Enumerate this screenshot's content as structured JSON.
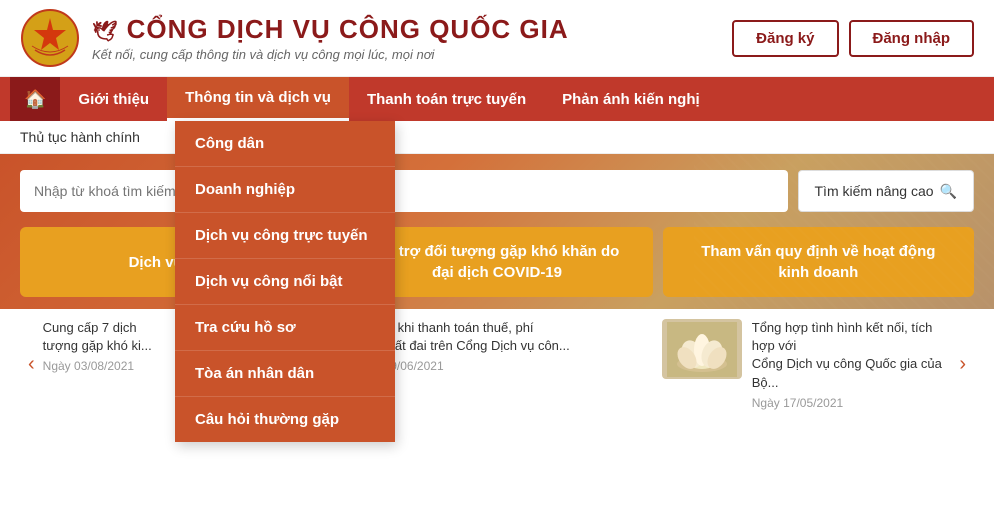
{
  "header": {
    "site_title": "CỔNG DỊCH VỤ CÔNG QUỐC GIA",
    "subtitle": "Kết nối, cung cấp thông tin và dịch vụ công mọi lúc, mọi nơi",
    "btn_register": "Đăng ký",
    "btn_login": "Đăng nhập"
  },
  "nav": {
    "home_icon": "🏠",
    "items": [
      {
        "label": "Giới thiệu",
        "active": false
      },
      {
        "label": "Thông tin và dịch vụ",
        "active": true
      },
      {
        "label": "Thanh toán trực tuyến",
        "active": false
      },
      {
        "label": "Phản ánh kiến nghị",
        "active": false
      }
    ]
  },
  "breadcrumb": "Thủ tục hành chính",
  "dropdown": {
    "items": [
      "Công dân",
      "Doanh nghiệp",
      "Dịch vụ công trực tuyến",
      "Dịch vụ công nổi bật",
      "Tra cứu hồ sơ",
      "Tòa án nhân dân",
      "Câu hỏi thường gặp"
    ]
  },
  "search": {
    "placeholder": "Nhập từ khoá tìm kiếm...",
    "advanced_label": "Tìm kiếm nâng cao",
    "search_icon": "🔍"
  },
  "action_buttons": [
    {
      "label": "Dịch vụ công",
      "wide": false
    },
    {
      "label": "Hỗ trợ đối tượng gặp khó khăn do\nđại dịch COVID-19",
      "wide": false
    },
    {
      "label": "Tham vấn quy định về hoạt động\nkinh doanh",
      "wide": false
    }
  ],
  "news": {
    "prev_icon": "‹",
    "next_icon": "›",
    "items": [
      {
        "text": "Cung cấp 7 dịch\ntượng gặp khó ki...",
        "date": "Ngày 03/08/2021"
      },
      {
        "text": "ích '5K' khi thanh toán thuế, phí\núc ba đất đai trên Cổng Dịch vụ côn...",
        "date": "Ngày 09/06/2021"
      },
      {
        "text": "Tổng hợp tình hình kết nối, tích hợp với\nCổng Dịch vụ công Quốc gia của Bộ...",
        "date": "Ngày 17/05/2021"
      }
    ]
  },
  "colors": {
    "primary": "#c9532a",
    "dark_red": "#8B1A1A",
    "gold": "#e8a020",
    "nav_bg": "#c0392b"
  }
}
